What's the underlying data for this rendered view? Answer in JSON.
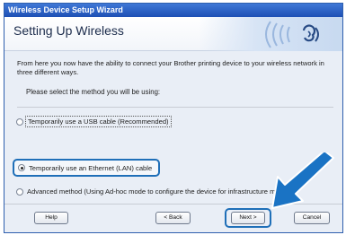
{
  "window": {
    "title": "Wireless Device Setup Wizard"
  },
  "header": {
    "title": "Setting Up Wireless"
  },
  "body": {
    "intro": "From here you now have the ability to connect your Brother printing device to your wireless network in three different ways.",
    "prompt": "Please select the method you will be using:",
    "options": [
      {
        "label": "Temporarily use a USB cable (Recommended)",
        "selected": false
      },
      {
        "label": "Temporarily use an Ethernet (LAN) cable",
        "selected": true
      },
      {
        "label": "Advanced method (Using Ad-hoc mode to configure the device for infrastructure mode)",
        "selected": false
      }
    ]
  },
  "buttons": {
    "help": "Help",
    "back": "< Back",
    "next": "Next >",
    "cancel": "Cancel"
  },
  "colors": {
    "highlight": "#1f6fb8",
    "arrow": "#1a73c4",
    "titlebar": "#2a5fc4"
  },
  "icons": [
    "wireless-arcs-icon",
    "pointer-arrow-icon"
  ]
}
